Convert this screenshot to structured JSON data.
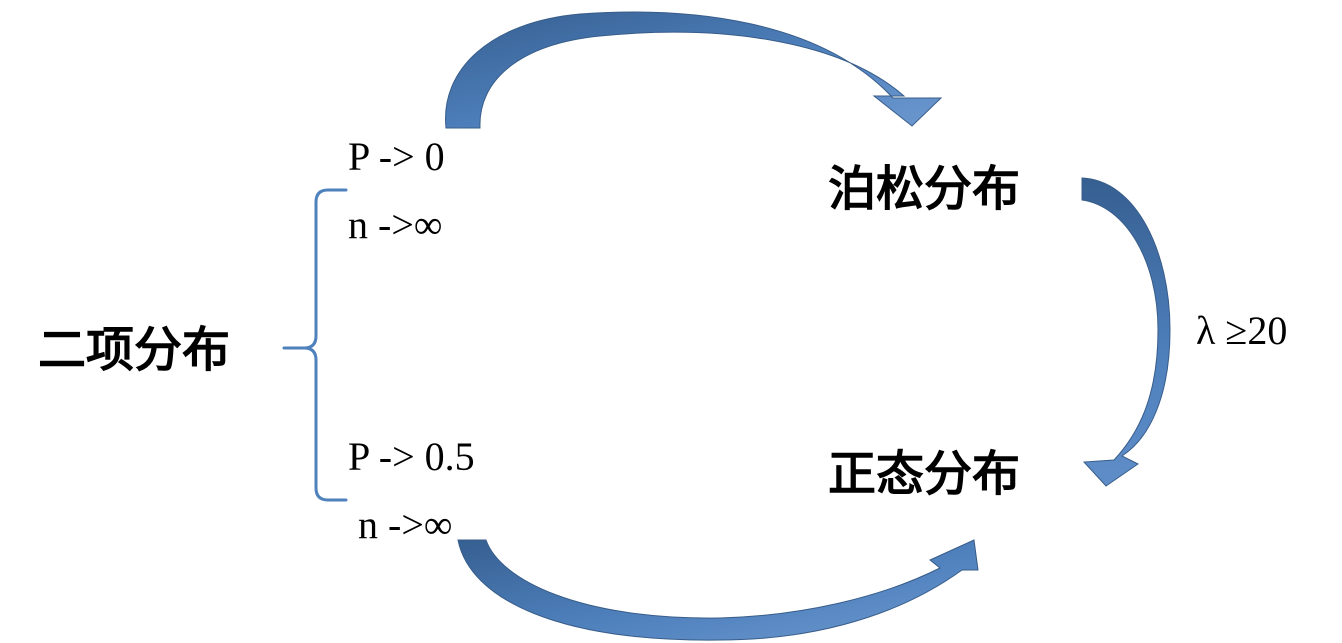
{
  "nodes": {
    "binomial": "二项分布",
    "poisson": "泊松分布",
    "normal": "正态分布"
  },
  "conditions": {
    "to_poisson_p": "P -> 0",
    "to_poisson_n": "n ->∞",
    "to_normal_p": "P -> 0.5",
    "to_normal_n": "n ->∞",
    "poisson_to_normal": "λ ≥20"
  },
  "colors": {
    "arrow_fill": "#4f81bd",
    "arrow_dark": "#365f91",
    "brace": "#4f81bd",
    "text": "#000000"
  }
}
